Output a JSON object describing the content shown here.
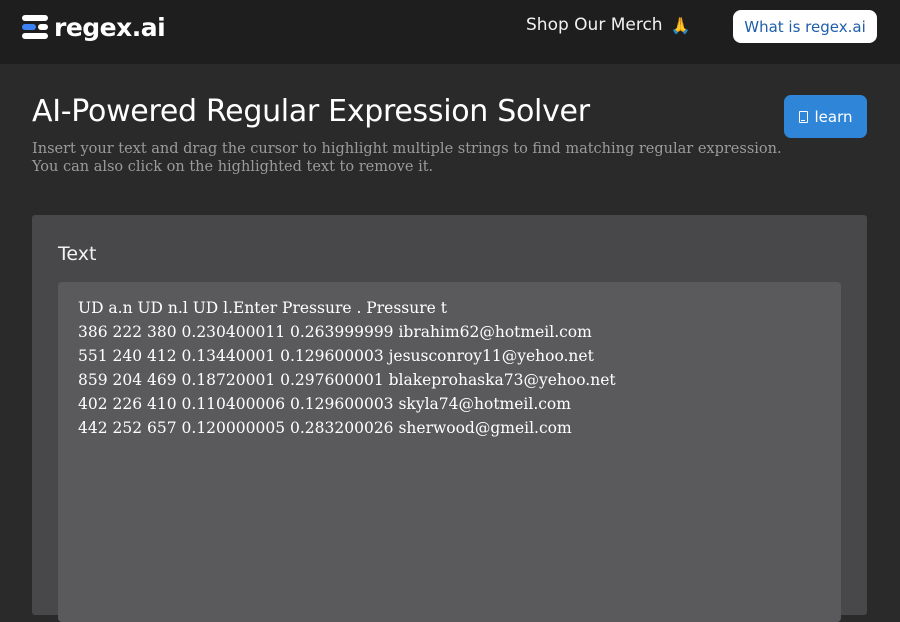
{
  "header": {
    "logo_text": "regex.ai",
    "merch_label": "Shop Our Merch",
    "merch_icon": "🙏",
    "about_button": "What is regex.ai"
  },
  "main": {
    "title": "AI-Powered Regular Expression Solver",
    "subtitle_line1": "Insert your text and drag the cursor to highlight multiple strings to find matching regular expression.",
    "subtitle_line2": "You can also click on the highlighted text to remove it.",
    "learn_button": "learn"
  },
  "text_card": {
    "heading": "Text",
    "lines": [
      "UD a.n UD n.l UD l.Enter Pressure . Pressure t",
      "386 222 380 0.230400011 0.263999999 ibrahim62@hotmeil.com",
      "551 240 412 0.13440001 0.129600003 jesusconroy11@yehoo.net",
      "859 204 469 0.18720001 0.297600001 blakeprohaska73@yehoo.net",
      "402 226 410 0.110400006 0.129600003 skyla74@hotmeil.com",
      "442 252 657 0.120000005 0.283200026 sherwood@gmeil.com"
    ]
  },
  "colors": {
    "background": "#2a2a2b",
    "topbar": "#1e1e1f",
    "accent": "#2f86d8",
    "card": "#48484a",
    "textarea": "#5a5a5d"
  }
}
